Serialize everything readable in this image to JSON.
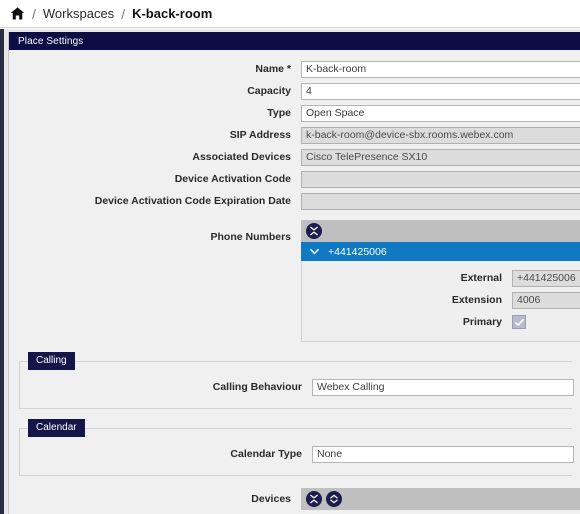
{
  "breadcrumb": {
    "home_icon": "home-icon",
    "separator": "/",
    "parent": "Workspaces",
    "current": "K-back-room"
  },
  "panel": {
    "title": "Place Settings"
  },
  "form": {
    "fields": [
      {
        "label": "Name *",
        "value": "K-back-room",
        "disabled": false
      },
      {
        "label": "Capacity",
        "value": "4",
        "disabled": false
      },
      {
        "label": "Type",
        "value": "Open Space",
        "disabled": false
      },
      {
        "label": "SIP Address",
        "value": "k-back-room@device-sbx.rooms.webex.com",
        "disabled": true
      },
      {
        "label": "Associated Devices",
        "value": "Cisco TelePresence SX10",
        "disabled": true
      },
      {
        "label": "Device Activation Code",
        "value": "",
        "disabled": true
      },
      {
        "label": "Device Activation Code Expiration Date",
        "value": "",
        "disabled": true
      }
    ]
  },
  "phone_numbers": {
    "label": "Phone Numbers",
    "toolbar": {
      "collapse_all_icon": "collapse-all-icon"
    },
    "entry": {
      "expand_icon": "chevron-down-icon",
      "number": "+441425006",
      "details": [
        {
          "label": "External",
          "value": "+441425006",
          "type": "text"
        },
        {
          "label": "Extension",
          "value": "4006",
          "type": "text"
        },
        {
          "label": "Primary",
          "value": "",
          "type": "checkbox",
          "checked": true
        }
      ]
    }
  },
  "sections": [
    {
      "tab": "Calling",
      "fields": [
        {
          "label": "Calling Behaviour",
          "value": "Webex Calling",
          "disabled": false
        }
      ]
    },
    {
      "tab": "Calendar",
      "fields": [
        {
          "label": "Calendar Type",
          "value": "None",
          "disabled": false
        }
      ]
    }
  ],
  "devices": {
    "label": "Devices",
    "toolbar": {
      "collapse_all_icon": "collapse-all-icon",
      "expand_all_icon": "expand-all-icon"
    }
  },
  "colors": {
    "navy_header": "#0d0d45",
    "section_tab": "#15154a",
    "accordion_selected": "#0f79c4",
    "toolbar_gray": "#bfbfbf",
    "disabled_field": "#dcdcdc",
    "checkbox_fill": "#b9b9cf"
  }
}
